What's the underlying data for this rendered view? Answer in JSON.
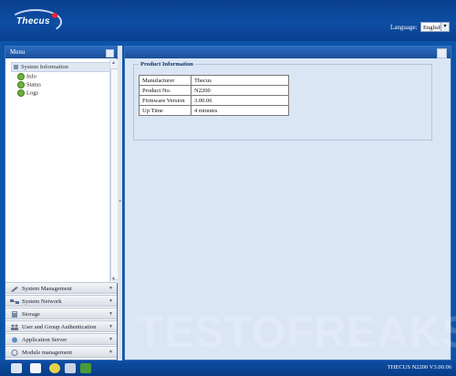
{
  "header": {
    "brand": "Thecus",
    "language_label": "Language:",
    "language_value": "English"
  },
  "menu": {
    "title": "Menu",
    "tree": {
      "section": "System Information",
      "items": [
        "Info",
        "Status",
        "Logs"
      ]
    },
    "sections": [
      "System Management",
      "System Network",
      "Storage",
      "User and Group Authentication",
      "Application Server",
      "Module management"
    ]
  },
  "content": {
    "legend": "Product Information",
    "rows": [
      {
        "label": "Manufacturer",
        "value": "Thecus"
      },
      {
        "label": "Product No.",
        "value": "N2200"
      },
      {
        "label": "Firmware Version",
        "value": "3.00.06"
      },
      {
        "label": "Up Time",
        "value": "4 minutes"
      }
    ]
  },
  "watermark": "TESTOFREAKS",
  "footer": {
    "version": "THECUS N2200 V3.00.06"
  }
}
